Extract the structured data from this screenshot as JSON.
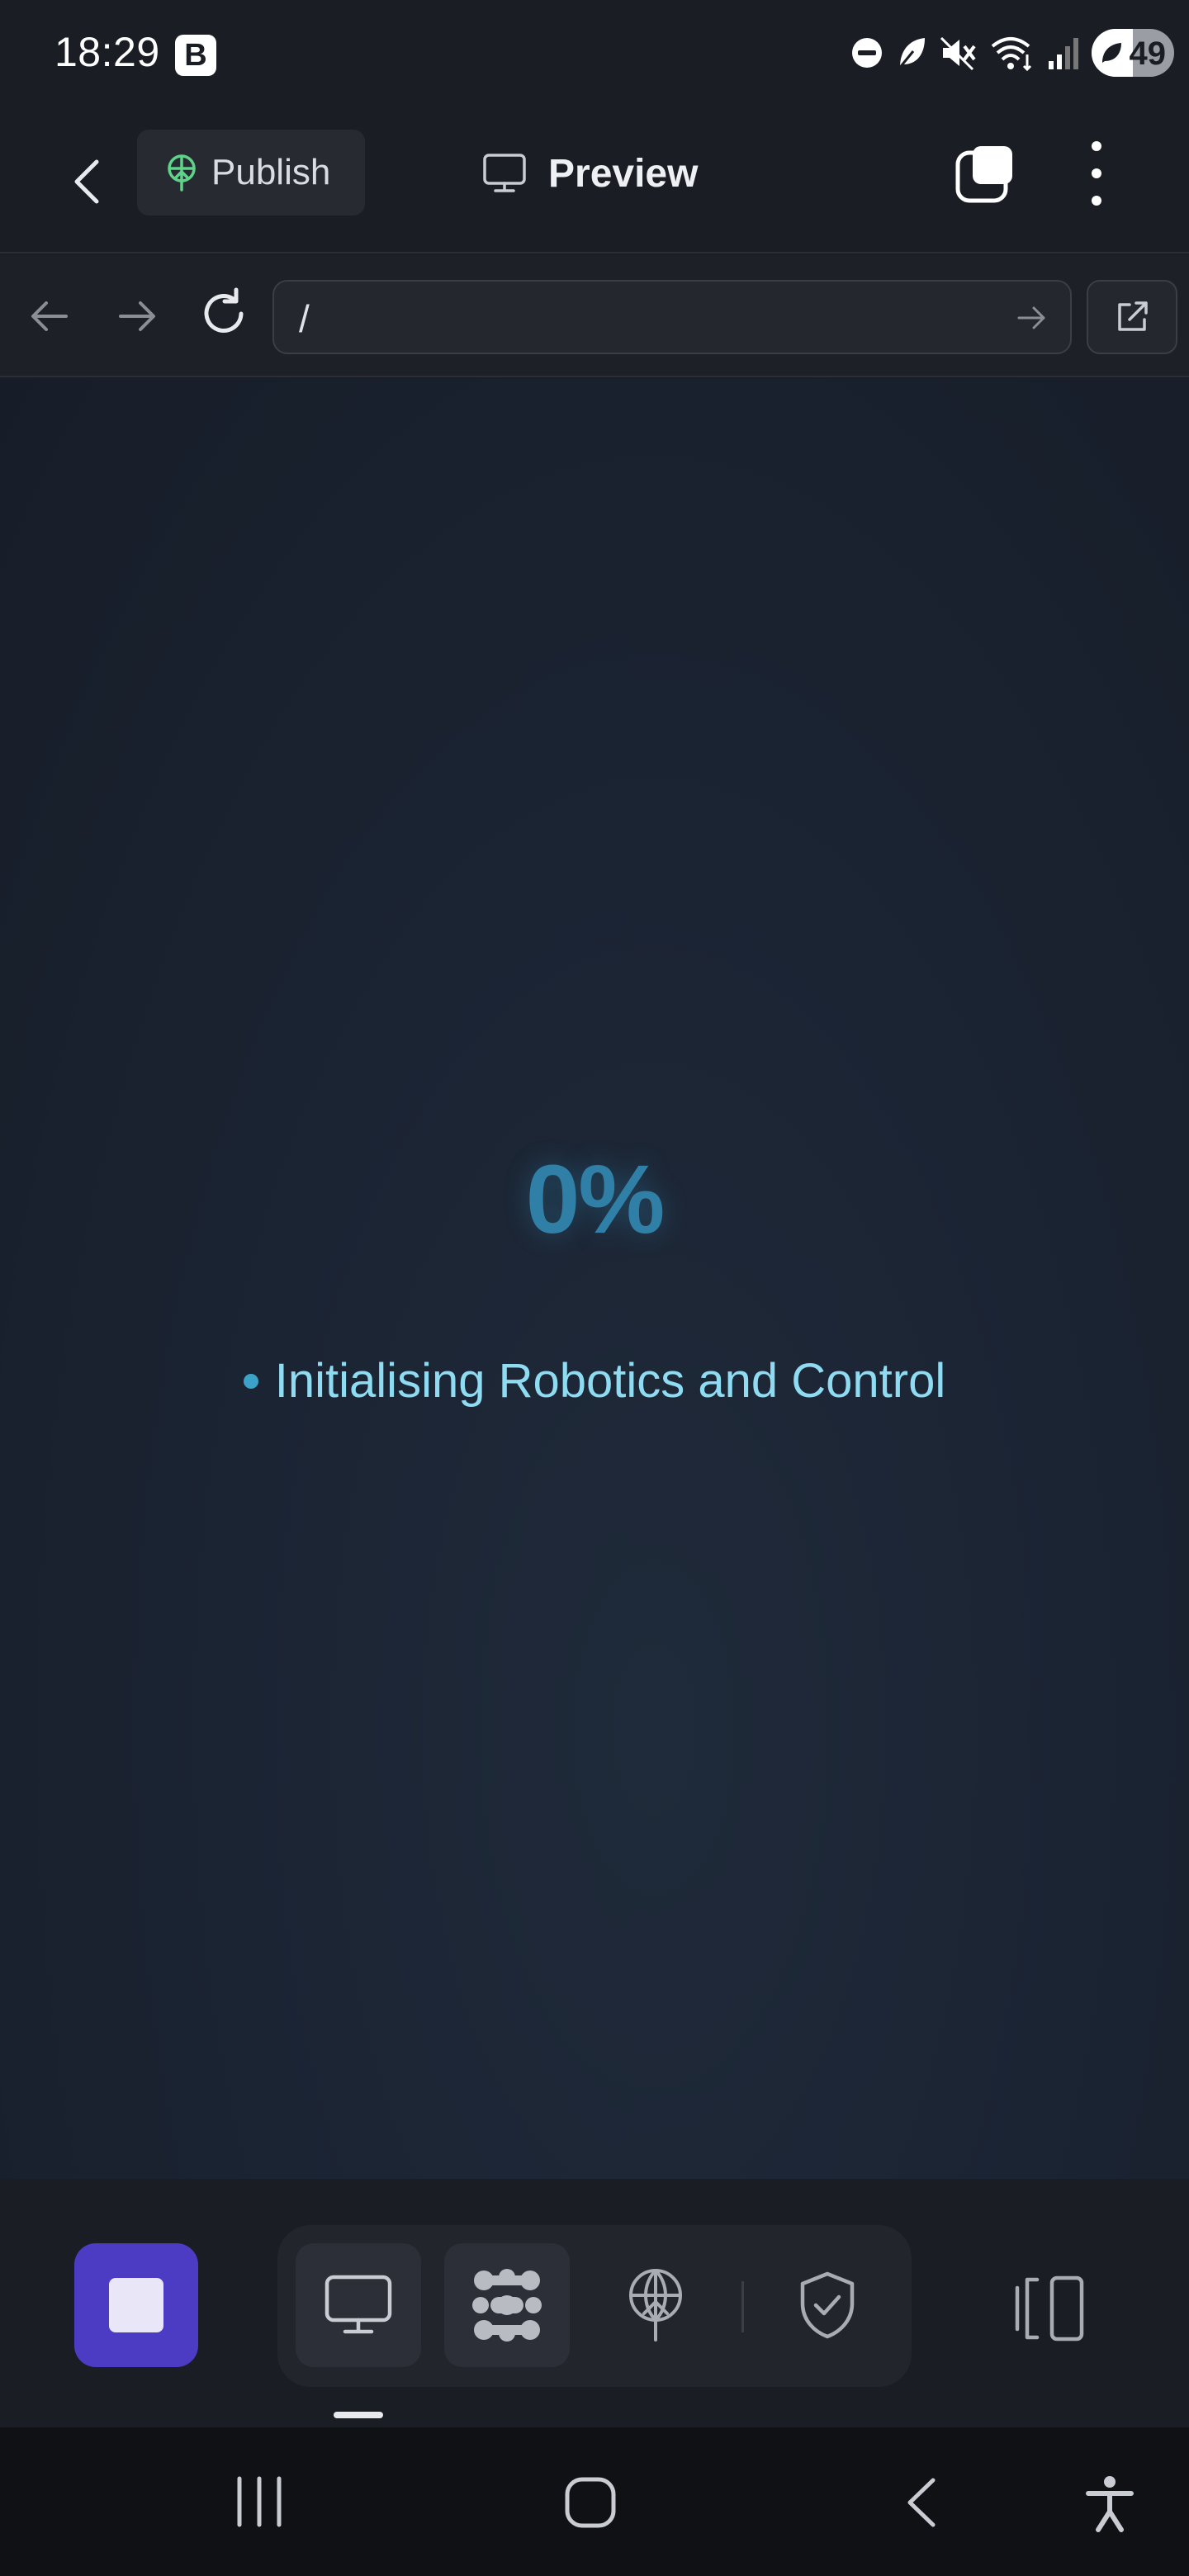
{
  "status_bar": {
    "time": "18:29",
    "app_badge": "B",
    "battery_level": "49"
  },
  "app_bar": {
    "publish_label": "Publish",
    "preview_label": "Preview"
  },
  "browser": {
    "url": "/"
  },
  "content": {
    "progress_percent": "0%",
    "status_text": "Initialising Robotics and Control"
  },
  "colors": {
    "accent_stop": "#4c3cc4",
    "progress_text": "#2f7fa6",
    "status_text": "#8fdcf2",
    "publish_icon": "#5fd38a"
  },
  "icons": {
    "top": [
      "back-icon",
      "publish-icon",
      "monitor-icon",
      "tabs-icon",
      "more-icon"
    ],
    "browser": [
      "arrow-left-icon",
      "arrow-right-icon",
      "reload-icon",
      "go-arrow-icon",
      "external-link-icon"
    ],
    "toolbar": [
      "stop-icon",
      "monitor-icon",
      "dots-grid-icon",
      "publish-icon",
      "shield-check-icon",
      "split-view-icon"
    ],
    "system": [
      "recents-icon",
      "home-icon",
      "system-back-icon",
      "accessibility-icon"
    ]
  }
}
